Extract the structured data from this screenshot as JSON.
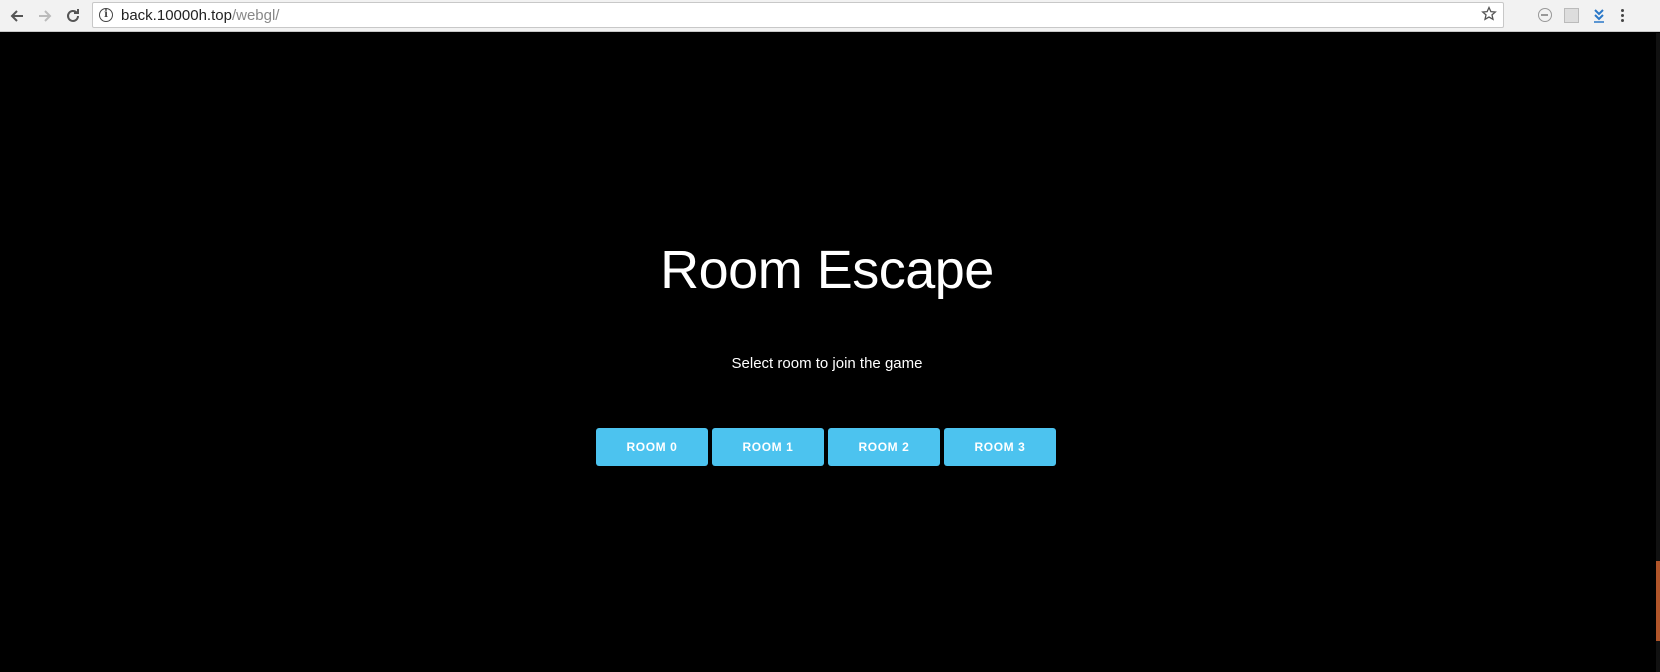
{
  "browser": {
    "url_host": "back.10000h.top",
    "url_path": "/webgl/",
    "icons": [
      "back-arrow-icon",
      "forward-arrow-icon",
      "reload-icon",
      "info-icon",
      "star-icon",
      "block-extension-icon",
      "grid-extension-icon",
      "download-extension-icon",
      "menu-dots-icon"
    ]
  },
  "page": {
    "title": "Room Escape",
    "subtitle": "Select room to join the game",
    "rooms": [
      "ROOM 0",
      "ROOM 1",
      "ROOM 2",
      "ROOM 3"
    ]
  },
  "colors": {
    "background": "#000000",
    "button": "#4cc3ef",
    "text": "#ffffff"
  }
}
